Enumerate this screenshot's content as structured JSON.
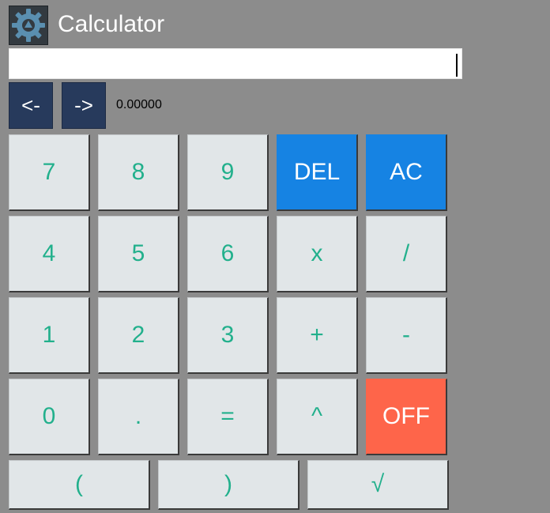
{
  "app": {
    "title": "Calculator",
    "icon": "gear-icon"
  },
  "display": {
    "value": ""
  },
  "history": {
    "back_label": "<-",
    "forward_label": "->",
    "value": "0.00000"
  },
  "keys": {
    "k7": "7",
    "k8": "8",
    "k9": "9",
    "del": "DEL",
    "ac": "AC",
    "k4": "4",
    "k5": "5",
    "k6": "6",
    "mul": "x",
    "div": "/",
    "k1": "1",
    "k2": "2",
    "k3": "3",
    "add": "+",
    "sub": "-",
    "k0": "0",
    "dot": ".",
    "eq": "=",
    "pow": "^",
    "off": "OFF",
    "lparen": "(",
    "rparen": ")",
    "sqrt": "√"
  },
  "colors": {
    "background": "#8c8c8c",
    "key_bg": "#e1e6e8",
    "key_text": "#22b08c",
    "accent_blue": "#1683e3",
    "accent_red": "#fe654a",
    "nav_bg": "#273a5c"
  }
}
